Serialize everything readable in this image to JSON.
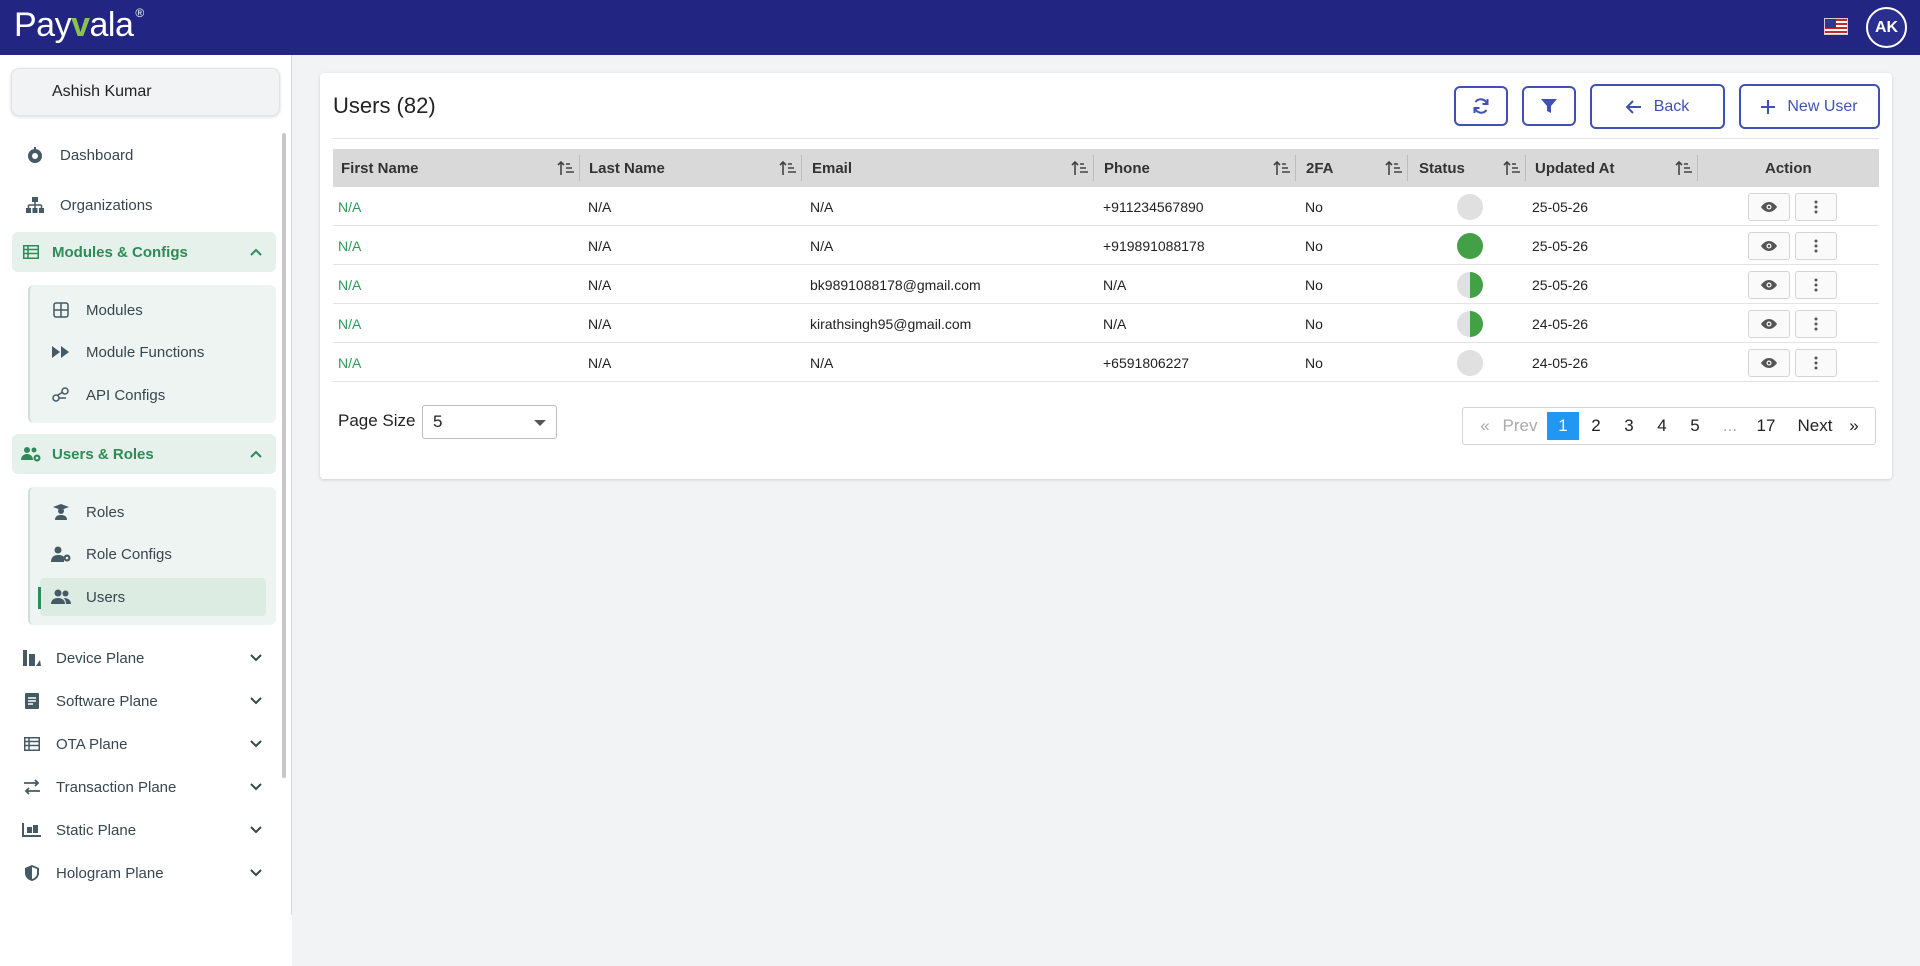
{
  "brand": {
    "name_start": "Pay",
    "name_v": "v",
    "name_end": "ala",
    "reg": "®"
  },
  "header": {
    "avatar_initials": "AK",
    "flag": "us-flag"
  },
  "sidebar": {
    "user_name": "Ashish Kumar",
    "items": [
      {
        "label": "Dashboard",
        "icon": "dashboard-icon"
      },
      {
        "label": "Organizations",
        "icon": "sitemap-icon"
      }
    ],
    "groups": [
      {
        "label": "Modules & Configs",
        "icon": "table-icon",
        "expanded": true,
        "items": [
          {
            "label": "Modules",
            "icon": "grid-icon"
          },
          {
            "label": "Module Functions",
            "icon": "fast-forward-icon"
          },
          {
            "label": "API Configs",
            "icon": "api-icon"
          }
        ]
      },
      {
        "label": "Users & Roles",
        "icon": "users-cog-icon",
        "expanded": true,
        "items": [
          {
            "label": "Roles",
            "icon": "graduate-icon"
          },
          {
            "label": "Role Configs",
            "icon": "user-cog-icon"
          },
          {
            "label": "Users",
            "icon": "users-icon",
            "active": true
          }
        ]
      }
    ],
    "planes": [
      {
        "label": "Device Plane",
        "icon": "device-icon"
      },
      {
        "label": "Software Plane",
        "icon": "software-icon"
      },
      {
        "label": "OTA Plane",
        "icon": "ota-icon"
      },
      {
        "label": "Transaction Plane",
        "icon": "exchange-icon"
      },
      {
        "label": "Static Plane",
        "icon": "static-icon"
      },
      {
        "label": "Hologram Plane",
        "icon": "shield-icon"
      }
    ]
  },
  "main": {
    "title": "Users (82)",
    "buttons": {
      "refresh_icon": "refresh-icon",
      "filter_icon": "filter-icon",
      "back": "Back",
      "new_user": "New User"
    },
    "table": {
      "columns": [
        "First Name",
        "Last Name",
        "Email",
        "Phone",
        "2FA",
        "Status",
        "Updated At",
        "Action"
      ],
      "rows": [
        {
          "first": "N/A",
          "last": "N/A",
          "email": "N/A",
          "phone": "+911234567890",
          "twofa": "No",
          "status": "inactive",
          "updated": "25-05-26"
        },
        {
          "first": "N/A",
          "last": "N/A",
          "email": "N/A",
          "phone": "+919891088178",
          "twofa": "No",
          "status": "active",
          "updated": "25-05-26"
        },
        {
          "first": "N/A",
          "last": "N/A",
          "email": "bk9891088178@gmail.com",
          "phone": "N/A",
          "twofa": "No",
          "status": "partial",
          "updated": "25-05-26"
        },
        {
          "first": "N/A",
          "last": "N/A",
          "email": "kirathsingh95@gmail.com",
          "phone": "N/A",
          "twofa": "No",
          "status": "partial",
          "updated": "24-05-26"
        },
        {
          "first": "N/A",
          "last": "N/A",
          "email": "N/A",
          "phone": "+6591806227",
          "twofa": "No",
          "status": "inactive",
          "updated": "24-05-26"
        }
      ]
    },
    "page_size": {
      "label": "Page Size",
      "value": "5"
    },
    "pagination": {
      "first": "«",
      "prev": "Prev",
      "pages": [
        "1",
        "2",
        "3",
        "4",
        "5",
        "...",
        "17"
      ],
      "current": "1",
      "next": "Next",
      "last": "»"
    }
  },
  "colors": {
    "topbar": "#222682",
    "accent_green": "#2e8b57",
    "accent_blue": "#3f51b5",
    "current_page": "#2196f3"
  }
}
